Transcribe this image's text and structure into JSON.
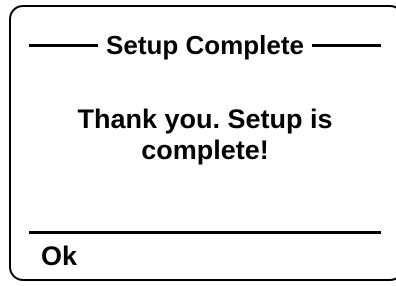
{
  "dialog": {
    "title": "Setup Complete",
    "message": "Thank you. Setup is complete!"
  },
  "actions": {
    "ok_label": "Ok"
  }
}
